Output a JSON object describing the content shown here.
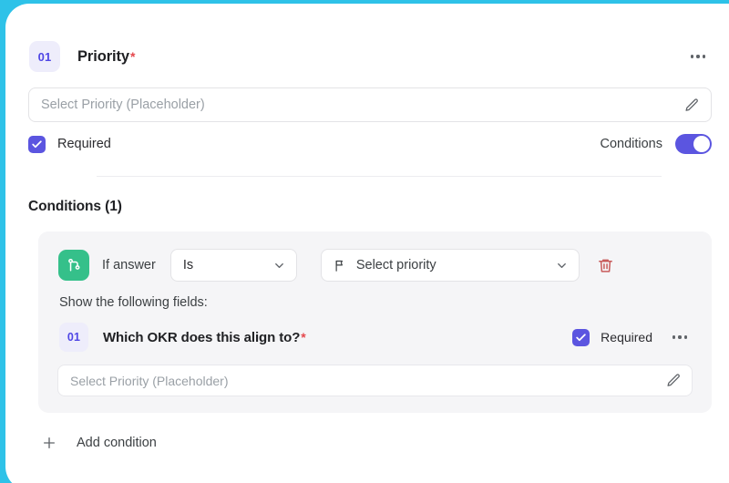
{
  "theme": {
    "page_background": "#2ec2e8",
    "card_background": "#ffffff",
    "accent_purple": "#5b55e0",
    "badge_text": "#4f46e5",
    "badge_background": "#eeedfb",
    "branch_green": "#35c08a",
    "trash_red": "#c85b5b",
    "required_star": "#e5484d",
    "panel_gray": "#f5f5f7"
  },
  "field": {
    "number": "01",
    "title": "Priority",
    "required_marker": "*",
    "menu_icon": "ellipsis-icon",
    "input": {
      "value": "",
      "placeholder": "Select Priority (Placeholder)",
      "edit_icon": "pencil-icon"
    },
    "required_checkbox": {
      "label": "Required",
      "checked": true
    },
    "conditions_toggle": {
      "label": "Conditions",
      "enabled": true
    }
  },
  "conditions_section": {
    "heading": "Conditions (1)",
    "count": 1,
    "condition": {
      "branch_icon": "branch-icon",
      "if_label": "If answer",
      "operator_select": {
        "value": "Is",
        "chevron_icon": "chevron-down-icon"
      },
      "value_select": {
        "value": "Select priority",
        "leading_icon": "flag-icon",
        "chevron_icon": "chevron-down-icon"
      },
      "delete_icon": "trash-icon",
      "show_fields_label": "Show the following fields:",
      "nested_field": {
        "number": "01",
        "title": "Which OKR does this align to?",
        "required_marker": "*",
        "required_checkbox": {
          "label": "Required",
          "checked": true
        },
        "menu_icon": "ellipsis-icon",
        "input": {
          "value": "",
          "placeholder": "Select Priority (Placeholder)",
          "edit_icon": "pencil-icon"
        }
      }
    },
    "add_condition": {
      "label": "Add condition",
      "icon": "plus-icon"
    }
  }
}
